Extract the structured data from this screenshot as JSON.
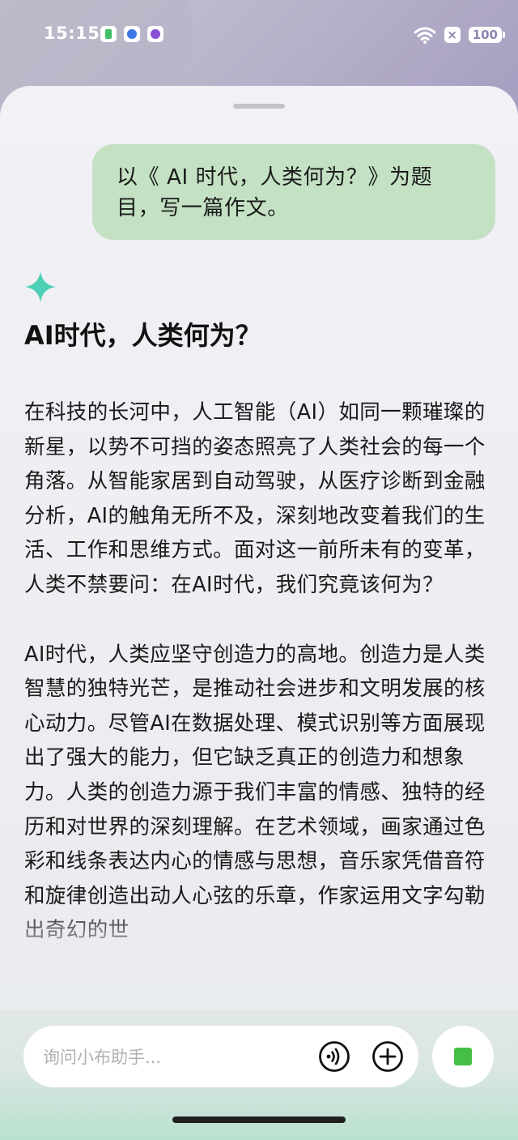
{
  "status_bar": {
    "time": "15:15",
    "battery": "100",
    "notification_close": "×"
  },
  "conversation": {
    "user_message": "以《 AI 时代，人类何为？》为题目，写一篇作文。",
    "answer_title": "AI时代，人类何为？",
    "answer_paragraphs": [
      "在科技的长河中，人工智能（AI）如同一颗璀璨的新星，以势不可挡的姿态照亮了人类社会的每一个角落。从智能家居到自动驾驶，从医疗诊断到金融分析，AI的触角无所不及，深刻地改变着我们的生活、工作和思维方式。面对这一前所未有的变革，人类不禁要问：在AI时代，我们究竟该何为？",
      "AI时代，人类应坚守创造力的高地。创造力是人类智慧的独特光芒，是推动社会进步和文明发展的核心动力。尽管AI在数据处理、模式识别等方面展现出了强大的能力，但它缺乏真正的创造力和想象力。人类的创造力源于我们丰富的情感、独特的经历和对世界的深刻理解。在艺术领域，画家通过色彩和线条表达内心的情感与思想，音乐家凭借音符和旋律创造出动人心弦的乐章，作家运用文字勾勒出奇幻的世"
    ]
  },
  "input": {
    "placeholder": "询问小布助手..."
  },
  "icons": {
    "sparkle": "sparkle-icon",
    "voice": "voice-call-icon",
    "add": "plus-circle-icon",
    "stop": "stop-icon"
  },
  "colors": {
    "user_bubble": "#c4e1c4",
    "sparkle": "#4ccfb5",
    "stop_square": "#45c045"
  }
}
